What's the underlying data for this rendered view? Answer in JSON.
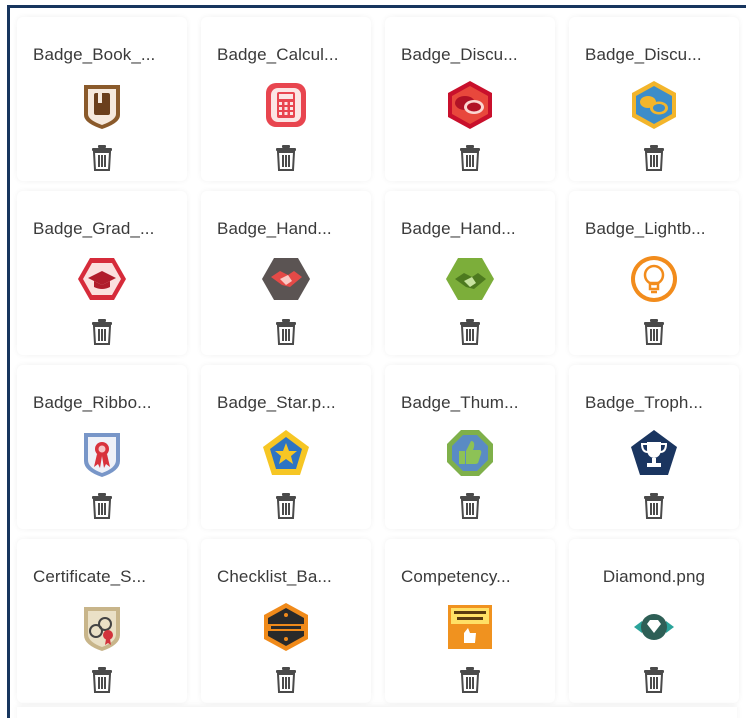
{
  "badges": [
    {
      "name": "Badge_Book_...",
      "icon": "book-badge-icon"
    },
    {
      "name": "Badge_Calcul...",
      "icon": "calculator-badge-icon"
    },
    {
      "name": "Badge_Discu...",
      "icon": "discussion-badge-icon"
    },
    {
      "name": "Badge_Discu...",
      "icon": "discussion-blue-badge-icon"
    },
    {
      "name": "Badge_Grad_...",
      "icon": "graduation-cap-badge-icon"
    },
    {
      "name": "Badge_Hand...",
      "icon": "handshake-badge-icon"
    },
    {
      "name": "Badge_Hand...",
      "icon": "handshake-green-badge-icon"
    },
    {
      "name": "Badge_Lightb...",
      "icon": "lightbulb-badge-icon"
    },
    {
      "name": "Badge_Ribbo...",
      "icon": "ribbon-badge-icon"
    },
    {
      "name": "Badge_Star.p...",
      "icon": "star-badge-icon"
    },
    {
      "name": "Badge_Thum...",
      "icon": "thumbs-up-badge-icon"
    },
    {
      "name": "Badge_Troph...",
      "icon": "trophy-badge-icon"
    },
    {
      "name": "Certificate_S...",
      "icon": "certificate-badge-icon"
    },
    {
      "name": "Checklist_Ba...",
      "icon": "checklist-badge-icon"
    },
    {
      "name": "Competency...",
      "icon": "competency-badge-icon"
    },
    {
      "name": "Diamond.png",
      "icon": "diamond-badge-icon"
    }
  ],
  "delete_icon": "trash-icon",
  "colors": {
    "frame_border": "#17355e",
    "text": "#3a3a3a",
    "trash": "#4a4a4a"
  }
}
